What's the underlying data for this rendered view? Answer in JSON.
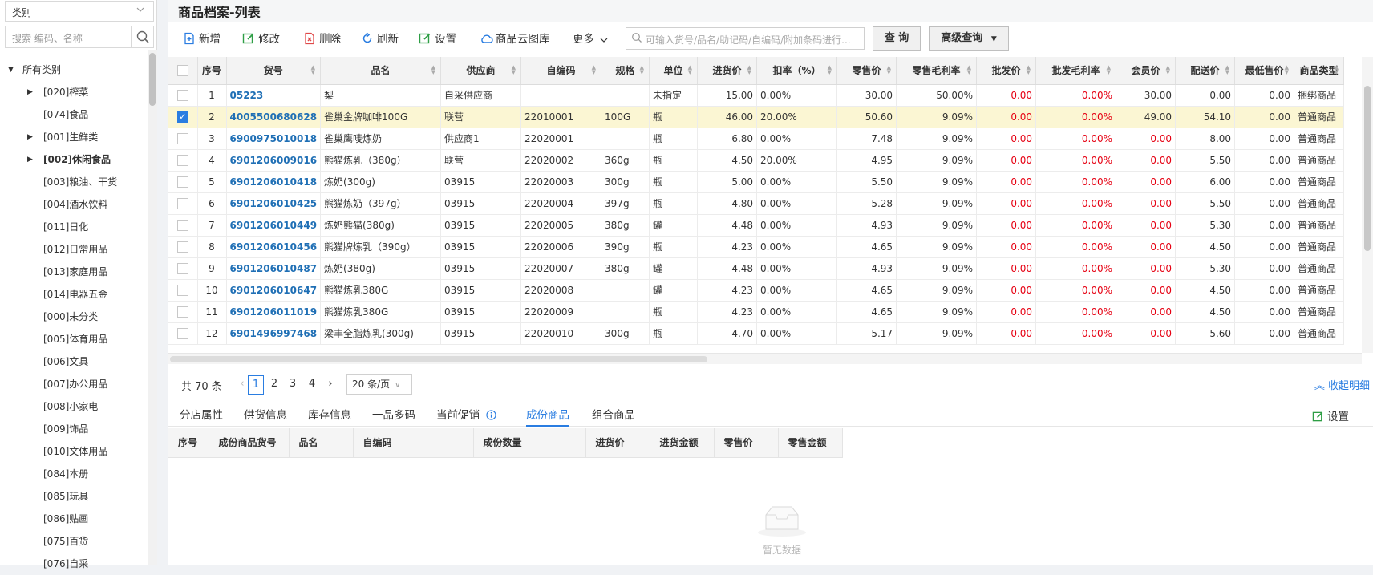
{
  "sidebar": {
    "category_select": "类别",
    "search_placeholder": "搜索 编码、名称",
    "tree": [
      {
        "label": "所有类别",
        "level": 0,
        "arrow": "expanded",
        "bold": false
      },
      {
        "label": "[020]榨菜",
        "level": 1,
        "arrow": "collapsed",
        "bold": false
      },
      {
        "label": "[074]食品",
        "level": 1,
        "arrow": "",
        "bold": false
      },
      {
        "label": "[001]生鲜类",
        "level": 1,
        "arrow": "collapsed",
        "bold": false
      },
      {
        "label": "[002]休闲食品",
        "level": 1,
        "arrow": "collapsed",
        "bold": true
      },
      {
        "label": "[003]粮油、干货",
        "level": 1,
        "arrow": "",
        "bold": false
      },
      {
        "label": "[004]酒水饮料",
        "level": 1,
        "arrow": "",
        "bold": false
      },
      {
        "label": "[011]日化",
        "level": 1,
        "arrow": "",
        "bold": false
      },
      {
        "label": "[012]日常用品",
        "level": 1,
        "arrow": "",
        "bold": false
      },
      {
        "label": "[013]家庭用品",
        "level": 1,
        "arrow": "",
        "bold": false
      },
      {
        "label": "[014]电器五金",
        "level": 1,
        "arrow": "",
        "bold": false
      },
      {
        "label": "[000]未分类",
        "level": 1,
        "arrow": "",
        "bold": false
      },
      {
        "label": "[005]体育用品",
        "level": 1,
        "arrow": "",
        "bold": false
      },
      {
        "label": "[006]文具",
        "level": 1,
        "arrow": "",
        "bold": false
      },
      {
        "label": "[007]办公用品",
        "level": 1,
        "arrow": "",
        "bold": false
      },
      {
        "label": "[008]小家电",
        "level": 1,
        "arrow": "",
        "bold": false
      },
      {
        "label": "[009]饰品",
        "level": 1,
        "arrow": "",
        "bold": false
      },
      {
        "label": "[010]文体用品",
        "level": 1,
        "arrow": "",
        "bold": false
      },
      {
        "label": "[084]本册",
        "level": 1,
        "arrow": "",
        "bold": false
      },
      {
        "label": "[085]玩具",
        "level": 1,
        "arrow": "",
        "bold": false
      },
      {
        "label": "[086]贴画",
        "level": 1,
        "arrow": "",
        "bold": false
      },
      {
        "label": "[075]百货",
        "level": 1,
        "arrow": "",
        "bold": false
      },
      {
        "label": "[076]自采",
        "level": 1,
        "arrow": "",
        "bold": false
      }
    ]
  },
  "page_title": "商品档案-列表",
  "toolbar": {
    "buttons": [
      {
        "label": "新增",
        "icon": "add-doc-icon",
        "color": "#2a7de1"
      },
      {
        "label": "修改",
        "icon": "edit-icon",
        "color": "#2e9e45"
      },
      {
        "label": "删除",
        "icon": "delete-doc-icon",
        "color": "#e04a4a"
      },
      {
        "label": "刷新",
        "icon": "refresh-icon",
        "color": "#2a7de1"
      },
      {
        "label": "设置",
        "icon": "settings-edit-icon",
        "color": "#2e9e45"
      },
      {
        "label": "商品云图库",
        "icon": "cloud-icon",
        "color": "#2a7de1"
      },
      {
        "label": "更多",
        "icon": "chevron-down-icon",
        "color": "#333333"
      }
    ],
    "search_placeholder": "可输入货号/品名/助记码/自编码/附加条码进行...",
    "query_label": "查 询",
    "advanced_label": "高级查询"
  },
  "table": {
    "columns": [
      "",
      "序号",
      "货号",
      "品名",
      "供应商",
      "自编码",
      "规格",
      "单位",
      "进货价",
      "扣率（%）",
      "零售价",
      "零售毛利率",
      "批发价",
      "批发毛利率",
      "会员价",
      "配送价",
      "最低售价",
      "商品类型"
    ],
    "rows": [
      {
        "checked": false,
        "no": "1",
        "code": "05223",
        "name": "梨",
        "supplier": "自采供应商",
        "selfcode": "",
        "spec": "",
        "unit": "未指定",
        "buy": "15.00",
        "rate": "0.00%",
        "retail": "30.00",
        "retail_margin": "50.00%",
        "wholesale": "0.00",
        "wholesale_margin": "0.00%",
        "member": "30.00",
        "member_red": false,
        "delivery": "0.00",
        "min": "0.00",
        "type": "捆绑商品"
      },
      {
        "checked": true,
        "no": "2",
        "code": "4005500680628",
        "name": "雀巢金牌咖啡100G",
        "supplier": "联营",
        "selfcode": "22010001",
        "spec": "100G",
        "unit": "瓶",
        "buy": "46.00",
        "rate": "20.00%",
        "retail": "50.60",
        "retail_margin": "9.09%",
        "wholesale": "0.00",
        "wholesale_margin": "0.00%",
        "member": "49.00",
        "member_red": false,
        "delivery": "54.10",
        "min": "0.00",
        "type": "普通商品"
      },
      {
        "checked": false,
        "no": "3",
        "code": "6900975010018",
        "name": "雀巢鹰唛炼奶",
        "supplier": "供应商1",
        "selfcode": "22020001",
        "spec": "",
        "unit": "瓶",
        "buy": "6.80",
        "rate": "0.00%",
        "retail": "7.48",
        "retail_margin": "9.09%",
        "wholesale": "0.00",
        "wholesale_margin": "0.00%",
        "member": "0.00",
        "member_red": true,
        "delivery": "8.00",
        "min": "0.00",
        "type": "普通商品"
      },
      {
        "checked": false,
        "no": "4",
        "code": "6901206009016",
        "name": "熊猫炼乳（380g）",
        "supplier": "联营",
        "selfcode": "22020002",
        "spec": "360g",
        "unit": "瓶",
        "buy": "4.50",
        "rate": "20.00%",
        "retail": "4.95",
        "retail_margin": "9.09%",
        "wholesale": "0.00",
        "wholesale_margin": "0.00%",
        "member": "0.00",
        "member_red": true,
        "delivery": "5.50",
        "min": "0.00",
        "type": "普通商品"
      },
      {
        "checked": false,
        "no": "5",
        "code": "6901206010418",
        "name": "炼奶(300g)",
        "supplier": "03915",
        "selfcode": "22020003",
        "spec": "300g",
        "unit": "瓶",
        "buy": "5.00",
        "rate": "0.00%",
        "retail": "5.50",
        "retail_margin": "9.09%",
        "wholesale": "0.00",
        "wholesale_margin": "0.00%",
        "member": "0.00",
        "member_red": true,
        "delivery": "6.00",
        "min": "0.00",
        "type": "普通商品"
      },
      {
        "checked": false,
        "no": "6",
        "code": "6901206010425",
        "name": "熊猫炼奶（397g）",
        "supplier": "03915",
        "selfcode": "22020004",
        "spec": "397g",
        "unit": "瓶",
        "buy": "4.80",
        "rate": "0.00%",
        "retail": "5.28",
        "retail_margin": "9.09%",
        "wholesale": "0.00",
        "wholesale_margin": "0.00%",
        "member": "0.00",
        "member_red": true,
        "delivery": "5.50",
        "min": "0.00",
        "type": "普通商品"
      },
      {
        "checked": false,
        "no": "7",
        "code": "6901206010449",
        "name": "炼奶熊猫(380g)",
        "supplier": "03915",
        "selfcode": "22020005",
        "spec": "380g",
        "unit": "罐",
        "buy": "4.48",
        "rate": "0.00%",
        "retail": "4.93",
        "retail_margin": "9.09%",
        "wholesale": "0.00",
        "wholesale_margin": "0.00%",
        "member": "0.00",
        "member_red": true,
        "delivery": "5.30",
        "min": "0.00",
        "type": "普通商品"
      },
      {
        "checked": false,
        "no": "8",
        "code": "6901206010456",
        "name": "熊猫牌炼乳（390g）",
        "supplier": "03915",
        "selfcode": "22020006",
        "spec": "390g",
        "unit": "瓶",
        "buy": "4.23",
        "rate": "0.00%",
        "retail": "4.65",
        "retail_margin": "9.09%",
        "wholesale": "0.00",
        "wholesale_margin": "0.00%",
        "member": "0.00",
        "member_red": true,
        "delivery": "4.50",
        "min": "0.00",
        "type": "普通商品"
      },
      {
        "checked": false,
        "no": "9",
        "code": "6901206010487",
        "name": "炼奶(380g)",
        "supplier": "03915",
        "selfcode": "22020007",
        "spec": "380g",
        "unit": "罐",
        "buy": "4.48",
        "rate": "0.00%",
        "retail": "4.93",
        "retail_margin": "9.09%",
        "wholesale": "0.00",
        "wholesale_margin": "0.00%",
        "member": "0.00",
        "member_red": true,
        "delivery": "5.30",
        "min": "0.00",
        "type": "普通商品"
      },
      {
        "checked": false,
        "no": "10",
        "code": "6901206010647",
        "name": "熊猫炼乳380G",
        "supplier": "03915",
        "selfcode": "22020008",
        "spec": "",
        "unit": "罐",
        "buy": "4.23",
        "rate": "0.00%",
        "retail": "4.65",
        "retail_margin": "9.09%",
        "wholesale": "0.00",
        "wholesale_margin": "0.00%",
        "member": "0.00",
        "member_red": true,
        "delivery": "4.50",
        "min": "0.00",
        "type": "普通商品"
      },
      {
        "checked": false,
        "no": "11",
        "code": "6901206011019",
        "name": "熊猫炼乳380G",
        "supplier": "03915",
        "selfcode": "22020009",
        "spec": "",
        "unit": "瓶",
        "buy": "4.23",
        "rate": "0.00%",
        "retail": "4.65",
        "retail_margin": "9.09%",
        "wholesale": "0.00",
        "wholesale_margin": "0.00%",
        "member": "0.00",
        "member_red": true,
        "delivery": "4.50",
        "min": "0.00",
        "type": "普通商品"
      },
      {
        "checked": false,
        "no": "12",
        "code": "6901496997468",
        "name": "梁丰全脂炼乳(300g)",
        "supplier": "03915",
        "selfcode": "22020010",
        "spec": "300g",
        "unit": "瓶",
        "buy": "4.70",
        "rate": "0.00%",
        "retail": "5.17",
        "retail_margin": "9.09%",
        "wholesale": "0.00",
        "wholesale_margin": "0.00%",
        "member": "0.00",
        "member_red": true,
        "delivery": "5.60",
        "min": "0.00",
        "type": "普通商品"
      }
    ]
  },
  "pager": {
    "total": "共 70 条",
    "pages": [
      "1",
      "2",
      "3",
      "4"
    ],
    "current": "1",
    "page_size": "20 条/页",
    "collapse": "收起明细"
  },
  "detail": {
    "tabs": [
      "分店属性",
      "供货信息",
      "库存信息",
      "一品多码",
      "当前促销",
      "成份商品",
      "组合商品"
    ],
    "active_tab": "成份商品",
    "settings": "设置",
    "columns": [
      "序号",
      "成份商品货号",
      "品名",
      "自编码",
      "成份数量",
      "进货价",
      "进货金额",
      "零售价",
      "零售金额"
    ],
    "empty": "暂无数据"
  }
}
